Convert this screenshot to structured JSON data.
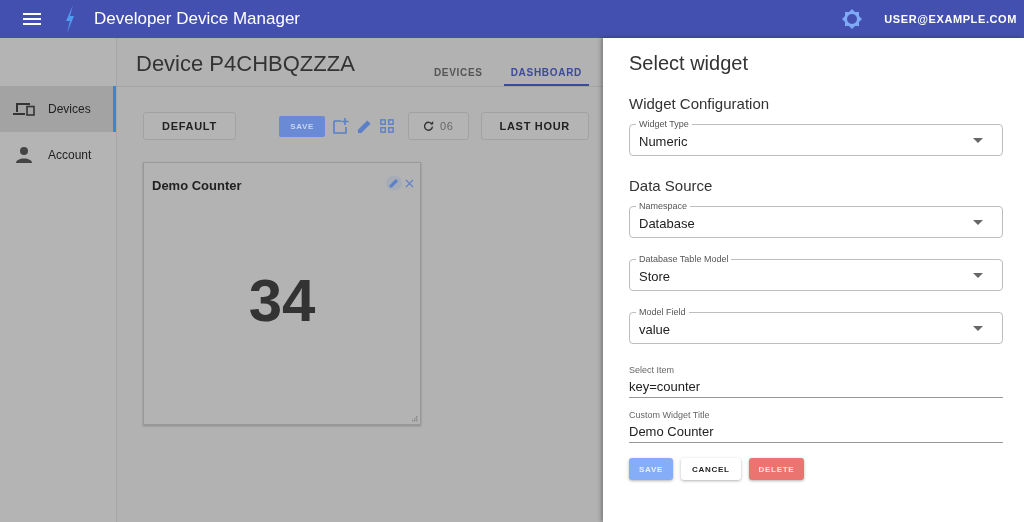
{
  "app_bar": {
    "title": "Developer Device Manager",
    "user": "USER@EXAMPLE.COM"
  },
  "sidebar": {
    "items": [
      {
        "kind": "devices",
        "label": "Devices",
        "selected": true
      },
      {
        "kind": "account",
        "label": "Account",
        "selected": false
      }
    ]
  },
  "page": {
    "title": "Device P4CHBQZZZA",
    "tabs": [
      {
        "label": "DEVICES",
        "selected": false
      },
      {
        "label": "DASHBOARD",
        "selected": true
      }
    ]
  },
  "toolbar": {
    "dashboard": "DEFAULT",
    "save": "SAVE",
    "refresh_interval": "06",
    "time_range": "LAST HOUR"
  },
  "widgets": [
    {
      "title": "Demo Counter",
      "value": "34"
    }
  ],
  "drawer": {
    "title": "Select widget",
    "sections": [
      {
        "heading": "Widget Configuration",
        "fields": [
          {
            "kind": "select",
            "label": "Widget Type",
            "value": "Numeric"
          }
        ]
      },
      {
        "heading": "Data Source",
        "fields": [
          {
            "kind": "select",
            "label": "Namespace",
            "value": "Database"
          },
          {
            "kind": "select",
            "label": "Database Table Model",
            "value": "Store"
          },
          {
            "kind": "select",
            "label": "Model Field",
            "value": "value"
          },
          {
            "kind": "text",
            "label": "Select Item",
            "value": "key=counter"
          },
          {
            "kind": "text",
            "label": "Custom Widget Title",
            "value": "Demo Counter"
          }
        ]
      }
    ],
    "buttons": [
      {
        "kind": "primary",
        "label": "SAVE"
      },
      {
        "kind": "plain",
        "label": "CANCEL"
      },
      {
        "kind": "danger",
        "label": "DELETE"
      }
    ]
  }
}
